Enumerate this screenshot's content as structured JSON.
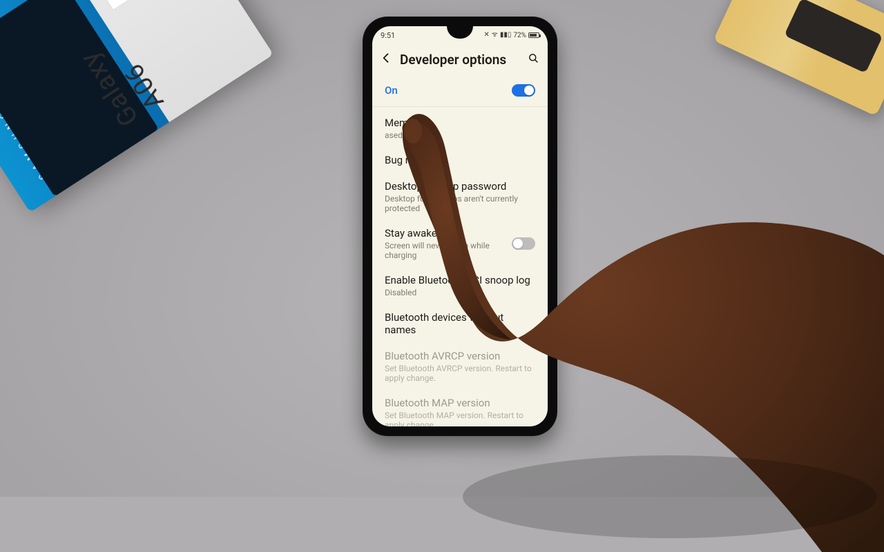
{
  "statusbar": {
    "time": "9:51",
    "battery_pct": "72%"
  },
  "header": {
    "title": "Developer options"
  },
  "master_toggle": {
    "label": "On",
    "on": true
  },
  "rows": [
    {
      "primary": "Memory",
      "secondary": "ased"
    },
    {
      "primary": "Bug report"
    },
    {
      "primary": "Desktop backup password",
      "secondary": "Desktop full backups aren't currently protected"
    },
    {
      "primary": "Stay awake",
      "secondary": "Screen will never sleep while charging",
      "toggle": {
        "on": false
      }
    },
    {
      "primary": "Enable Bluetooth HCI snoop log",
      "secondary": "Disabled"
    },
    {
      "primary": "Bluetooth devices without names"
    },
    {
      "primary": "Bluetooth AVRCP version",
      "secondary": "Set Bluetooth AVRCP version. Restart to apply change.",
      "muted": true
    },
    {
      "primary": "Bluetooth MAP version",
      "secondary": "Set Bluetooth MAP version. Restart to apply change.",
      "muted": true
    }
  ],
  "product_box": {
    "brand": "SAMSUNG",
    "model": "Galaxy A06"
  },
  "colors": {
    "accent": "#1f6fe5",
    "screen_bg": "#f6f4e6"
  }
}
